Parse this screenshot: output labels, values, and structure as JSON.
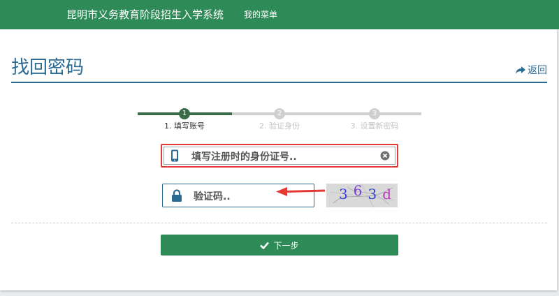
{
  "header": {
    "system_title": "昆明市义务教育阶段招生入学系统",
    "menu_label": "我的菜单"
  },
  "page": {
    "title": "找回密码",
    "back_label": "返回"
  },
  "steps": [
    {
      "number": "1",
      "label": "1. 填写账号",
      "active": true
    },
    {
      "number": "2",
      "label": "2. 验证身份",
      "active": false
    },
    {
      "number": "3",
      "label": "3. 设置新密码",
      "active": false
    }
  ],
  "form": {
    "id_placeholder": "填写注册时的身份证号..",
    "captcha_placeholder": "验证码..",
    "captcha_text": "363d",
    "next_label": "下一步"
  },
  "colors": {
    "brand_green": "#2e8b57",
    "title_blue": "#2b6a93",
    "highlight_red": "#e53935"
  },
  "icons": [
    "phone-icon",
    "clear-icon",
    "lock-icon",
    "check-icon",
    "back-arrow-icon"
  ]
}
